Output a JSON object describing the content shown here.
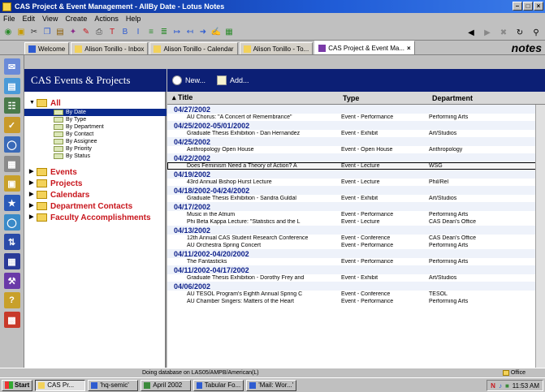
{
  "window": {
    "title": "CAS Project & Event Management - AllBy Date - Lotus Notes"
  },
  "menu": [
    "File",
    "Edit",
    "View",
    "Create",
    "Actions",
    "Help"
  ],
  "tabs": [
    {
      "label": "Welcome",
      "active": false
    },
    {
      "label": "Alison Tonillo - Inbox",
      "active": false
    },
    {
      "label": "Alison Tonillo - Calendar",
      "active": false
    },
    {
      "label": "Alison Tonillo - To...",
      "active": false
    },
    {
      "label": "CAS Project & Event Ma...",
      "active": true
    }
  ],
  "brand": "notes",
  "nav": {
    "title": "CAS Events & Projects",
    "all_label": "All",
    "views": [
      "By Date",
      "By Type",
      "By Department",
      "By Contact",
      "By Assignee",
      "By Priority",
      "By Status"
    ],
    "selected_view": "By Date",
    "sections": [
      "Events",
      "Projects",
      "Calendars",
      "Department Contacts",
      "Faculty Accomplishments"
    ]
  },
  "actions": {
    "new": "New...",
    "add": "Add..."
  },
  "columns": {
    "title": "Title",
    "type": "Type",
    "department": "Department"
  },
  "groups": [
    {
      "date": "04/27/2002",
      "rows": [
        {
          "title": "AU Chorus: \"A Concert of Remembrance\"",
          "type": "Event - Performance",
          "dept": "Performing Arts"
        }
      ]
    },
    {
      "date": "04/25/2002-05/01/2002",
      "rows": [
        {
          "title": "Graduate Thesis Exhibition - Dan Hernandez",
          "type": "Event - Exhibit",
          "dept": "Art/Studios"
        }
      ]
    },
    {
      "date": "04/25/2002",
      "rows": [
        {
          "title": "Anthropology Open House",
          "type": "Event - Open House",
          "dept": "Anthropology"
        }
      ]
    },
    {
      "date": "04/22/2002",
      "rows": [
        {
          "title": "Does Feminism Need a Theory of Action? A",
          "type": "Event - Lecture",
          "dept": "WSG",
          "highlight": true
        }
      ]
    },
    {
      "date": "04/19/2002",
      "rows": [
        {
          "title": "43rd Annual Bishop Hurst Lecture",
          "type": "Event - Lecture",
          "dept": "Phil/Rel"
        }
      ]
    },
    {
      "date": "04/18/2002-04/24/2002",
      "rows": [
        {
          "title": "Graduate Thesis Exhibition - Sandra Guldal",
          "type": "Event - Exhibit",
          "dept": "Art/Studios"
        }
      ]
    },
    {
      "date": "04/17/2002",
      "rows": [
        {
          "title": "Music in the Atrium",
          "type": "Event - Performance",
          "dept": "Performing Arts"
        },
        {
          "title": "Phi Beta Kappa Lecture: \"Statistics and the L",
          "type": "Event - Lecture",
          "dept": "CAS Dean's Office"
        }
      ]
    },
    {
      "date": "04/13/2002",
      "rows": [
        {
          "title": "12th Annual CAS Student Research Conference",
          "type": "Event - Conference",
          "dept": "CAS Dean's Office"
        },
        {
          "title": "AU Orchestra Spring Concert",
          "type": "Event - Performance",
          "dept": "Performing Arts"
        }
      ]
    },
    {
      "date": "04/11/2002-04/20/2002",
      "rows": [
        {
          "title": "The Fantasticks",
          "type": "Event - Performance",
          "dept": "Performing Arts"
        }
      ]
    },
    {
      "date": "04/11/2002-04/17/2002",
      "rows": [
        {
          "title": "Graduate Thesis Exhibition - Dorothy Frey and",
          "type": "Event - Exhibit",
          "dept": "Art/Studios"
        }
      ]
    },
    {
      "date": "04/06/2002",
      "rows": [
        {
          "title": "AU TESOL Program's Eighth Annual Spring C",
          "type": "Event - Conference",
          "dept": "TESOL"
        },
        {
          "title": "AU Chamber Singers: Matters of the Heart",
          "type": "Event - Performance",
          "dept": "Performing Arts"
        }
      ]
    }
  ],
  "status": {
    "message": "Doing database on LAS05/AMPB/American(L)",
    "office": "Office"
  },
  "taskbar": {
    "start": "Start",
    "tasks": [
      "CAS Pr...",
      "'hq-semic'",
      "April 2002",
      "Tabular Fo...",
      "'Mail: Wor...'"
    ],
    "time": "11:53 AM"
  }
}
